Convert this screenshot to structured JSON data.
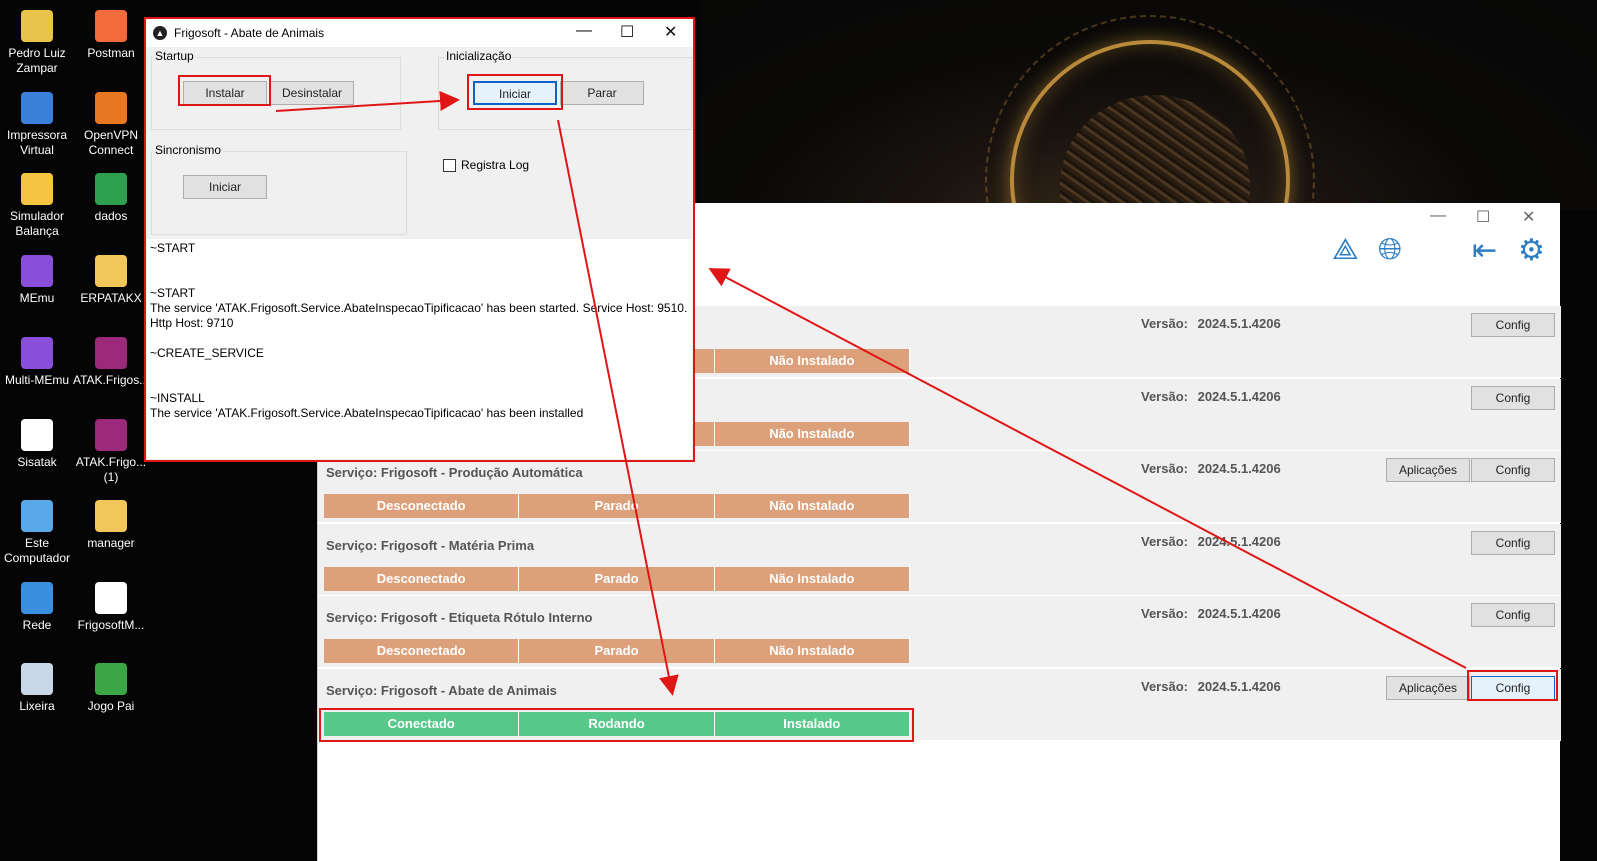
{
  "desktop": {
    "icons": [
      {
        "name": "user-folder-icon",
        "label": "Pedro Luiz Zampar",
        "color": "#e8c54a"
      },
      {
        "name": "postman-icon",
        "label": "Postman",
        "color": "#f26b3a"
      },
      {
        "name": "printer-icon",
        "label": "Impressora Virtual",
        "color": "#3a7fd8"
      },
      {
        "name": "openvpn-icon",
        "label": "OpenVPN Connect",
        "color": "#e87722"
      },
      {
        "name": "scale-simulator-icon",
        "label": "Simulador Balança",
        "color": "#f5c542"
      },
      {
        "name": "spreadsheet-icon",
        "label": "dados",
        "color": "#2e9e4f"
      },
      {
        "name": "memu-icon",
        "label": "MEmu",
        "color": "#8a4fd8"
      },
      {
        "name": "folder-icon",
        "label": "ERPATAKX",
        "color": "#f1c75b"
      },
      {
        "name": "multi-memu-icon",
        "label": "Multi-MEmu",
        "color": "#8a4fd8"
      },
      {
        "name": "winrar-icon",
        "label": "ATAK.Frigos...",
        "color": "#9c2a7a"
      },
      {
        "name": "sisatak-icon",
        "label": "Sisatak",
        "color": "#ffffff"
      },
      {
        "name": "winrar-icon-2",
        "label": "ATAK.Frigo... (1)",
        "color": "#9c2a7a"
      },
      {
        "name": "computer-icon",
        "label": "Este Computador",
        "color": "#5aa8e8"
      },
      {
        "name": "folder-manager-icon",
        "label": "manager",
        "color": "#f1c75b"
      },
      {
        "name": "network-icon",
        "label": "Rede",
        "color": "#3a8fe0"
      },
      {
        "name": "frigosoft-icon",
        "label": "FrigosoftM...",
        "color": "#ffffff"
      },
      {
        "name": "recycle-bin-icon",
        "label": "Lixeira",
        "color": "#c9d7e6"
      },
      {
        "name": "game-icon",
        "label": "Jogo Pai",
        "color": "#3aa645"
      }
    ]
  },
  "app": {
    "services": [
      {
        "name": "",
        "version_label": "Versão:",
        "version": "2024.5.1.4206",
        "apps_button": "",
        "config_button": "Config",
        "status": [
          "",
          "",
          "Não Instalado"
        ],
        "state": "off"
      },
      {
        "name": "",
        "version_label": "Versão:",
        "version": "2024.5.1.4206",
        "apps_button": "",
        "config_button": "Config",
        "status": [
          "",
          "",
          "Não Instalado"
        ],
        "state": "off"
      },
      {
        "name": "Serviço: Frigosoft - Produção Automática",
        "version_label": "Versão:",
        "version": "2024.5.1.4206",
        "apps_button": "Aplicações",
        "config_button": "Config",
        "status": [
          "Desconectado",
          "Parado",
          "Não Instalado"
        ],
        "state": "off"
      },
      {
        "name": "Serviço: Frigosoft - Matéria Prima",
        "version_label": "Versão:",
        "version": "2024.5.1.4206",
        "apps_button": "",
        "config_button": "Config",
        "status": [
          "Desconectado",
          "Parado",
          "Não Instalado"
        ],
        "state": "off"
      },
      {
        "name": "Serviço: Frigosoft - Etiqueta Rótulo Interno",
        "version_label": "Versão:",
        "version": "2024.5.1.4206",
        "apps_button": "",
        "config_button": "Config",
        "status": [
          "Desconectado",
          "Parado",
          "Não Instalado"
        ],
        "state": "off"
      },
      {
        "name": "Serviço: Frigosoft - Abate de Animais",
        "version_label": "Versão:",
        "version": "2024.5.1.4206",
        "apps_button": "Aplicações",
        "config_button": "Config",
        "status": [
          "Conectado",
          "Rodando",
          "Instalado"
        ],
        "state": "on"
      }
    ],
    "colors": {
      "not_installed": "#dca07a",
      "installed": "#56c88a",
      "accent": "#2c7ec4"
    }
  },
  "dialog": {
    "title": "Frigosoft - Abate de Animais",
    "startup_label": "Startup",
    "install_button": "Instalar",
    "uninstall_button": "Desinstalar",
    "init_label": "Inicialização",
    "start_button": "Iniciar",
    "stop_button": "Parar",
    "sync_label": "Sincronismo",
    "sync_start_button": "Iniciar",
    "log_checkbox": "Registra Log",
    "log_lines": [
      "~START",
      "",
      "",
      "~START",
      "The service 'ATAK.Frigosoft.Service.AbateInspecaoTipificacao' has been started. Service Host: 9510. Http Host: 9710",
      "",
      "~CREATE_SERVICE",
      "",
      "",
      "~INSTALL",
      "The service 'ATAK.Frigosoft.Service.AbateInspecaoTipificacao' has been installed"
    ]
  },
  "annotation_color": "#e01515"
}
